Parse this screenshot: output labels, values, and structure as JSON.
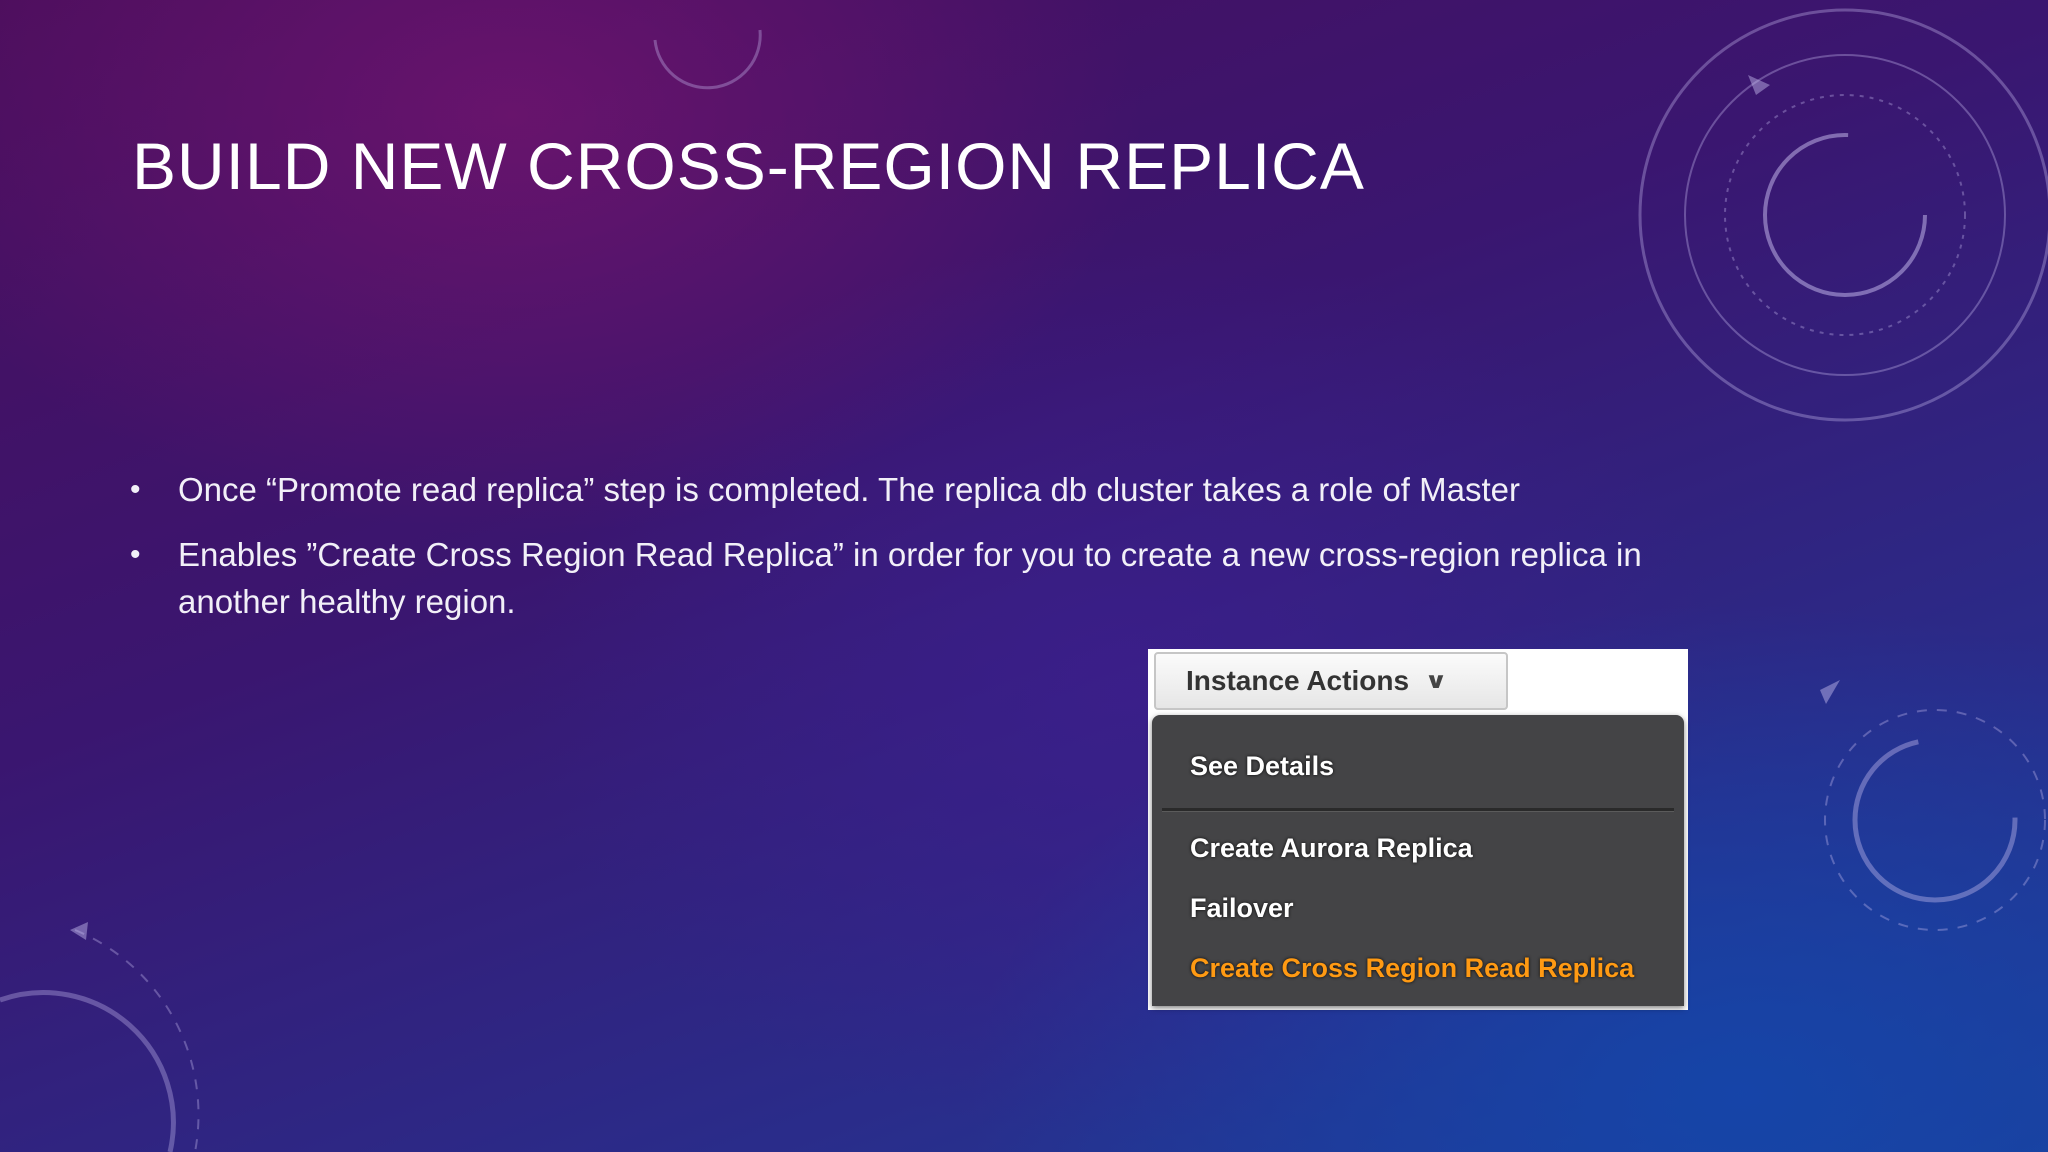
{
  "slide": {
    "title": "BUILD NEW CROSS-REGION REPLICA",
    "bullets": [
      "Once “Promote read replica” step is completed. The replica db cluster takes a role of Master",
      "Enables ”Create Cross Region Read Replica” in order for you to create a new cross-region replica in another healthy region."
    ],
    "bullet_glyph": "•"
  },
  "actions": {
    "button_label": "Instance Actions",
    "chevron_icon": "chevron-down-icon",
    "menu": {
      "see_details": "See Details",
      "create_aurora_replica": "Create Aurora Replica",
      "failover": "Failover",
      "create_cross_region": "Create Cross Region Read Replica"
    },
    "highlight_color": "#ff9a13"
  }
}
